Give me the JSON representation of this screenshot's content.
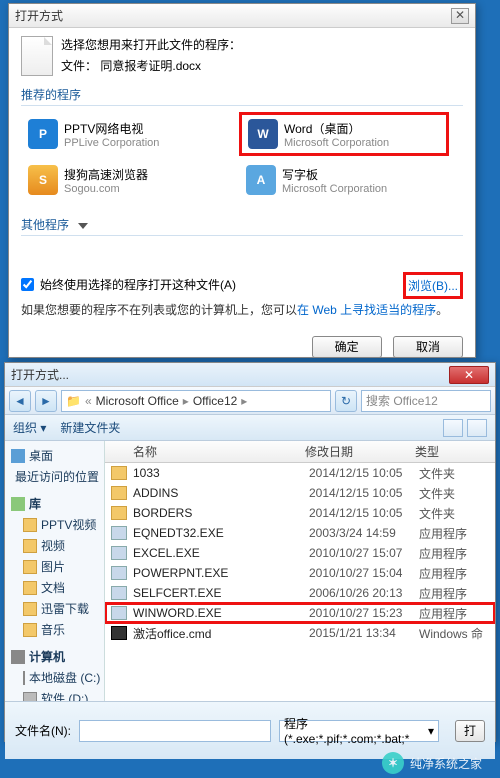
{
  "dlg1": {
    "title": "打开方式",
    "prompt_line1": "选择您想用来打开此文件的程序：",
    "prompt_line2_label": "文件：",
    "filename": "同意报考证明.docx",
    "section_recommended": "推荐的程序",
    "programs": [
      {
        "name": "PPTV网络电视",
        "vendor": "PPLive Corporation",
        "icon": "pptv",
        "hl": false
      },
      {
        "name": "Word（桌面）",
        "vendor": "Microsoft Corporation",
        "icon": "word",
        "hl": true
      },
      {
        "name": "搜狗高速浏览器",
        "vendor": "Sogou.com",
        "icon": "sogou",
        "hl": false
      },
      {
        "name": "写字板",
        "vendor": "Microsoft Corporation",
        "icon": "wordpad",
        "hl": false
      }
    ],
    "section_other": "其他程序",
    "checkbox_label": "始终使用选择的程序打开这种文件(A)",
    "browse_label": "浏览(B)...",
    "web_tip_prefix": "如果您想要的程序不在列表或您的计算机上，您可以",
    "web_tip_link": "在 Web 上寻找适当的程序",
    "web_tip_suffix": "。",
    "ok": "确定",
    "cancel": "取消"
  },
  "dlg2": {
    "title": "打开方式...",
    "path_segments": [
      "Microsoft Office",
      "Office12"
    ],
    "search_placeholder": "搜索 Office12",
    "toolbar": {
      "organize": "组织 ▾",
      "newfolder": "新建文件夹"
    },
    "sidebar": {
      "desktop": "桌面",
      "recent": "最近访问的位置",
      "library": "库",
      "pptv": "PPTV视频",
      "video": "视频",
      "pictures": "图片",
      "documents": "文档",
      "xunlei": "迅雷下载",
      "music": "音乐",
      "computer": "计算机",
      "disk_c": "本地磁盘 (C:)",
      "disk_soft": "软件 (D:)"
    },
    "columns": {
      "name": "名称",
      "date": "修改日期",
      "type": "类型"
    },
    "files": [
      {
        "name": "1033",
        "date": "2014/12/15 10:05",
        "type": "文件夹",
        "icon": "folder"
      },
      {
        "name": "ADDINS",
        "date": "2014/12/15 10:05",
        "type": "文件夹",
        "icon": "folder"
      },
      {
        "name": "BORDERS",
        "date": "2014/12/15 10:05",
        "type": "文件夹",
        "icon": "folder"
      },
      {
        "name": "EQNEDT32.EXE",
        "date": "2003/3/24 14:59",
        "type": "应用程序",
        "icon": "exe"
      },
      {
        "name": "EXCEL.EXE",
        "date": "2010/10/27 15:07",
        "type": "应用程序",
        "icon": "exe"
      },
      {
        "name": "POWERPNT.EXE",
        "date": "2010/10/27 15:04",
        "type": "应用程序",
        "icon": "exe"
      },
      {
        "name": "SELFCERT.EXE",
        "date": "2006/10/26 20:13",
        "type": "应用程序",
        "icon": "exe"
      },
      {
        "name": "WINWORD.EXE",
        "date": "2010/10/27 15:23",
        "type": "应用程序",
        "icon": "exe",
        "hl": true
      },
      {
        "name": "激活office.cmd",
        "date": "2015/1/21 13:34",
        "type": "Windows 命",
        "icon": "cmd"
      }
    ],
    "filename_label": "文件名(N):",
    "filter": "程序 (*.exe;*.pif;*.com;*.bat;*",
    "open_btn": "打"
  },
  "watermark": "纯净系统之家"
}
